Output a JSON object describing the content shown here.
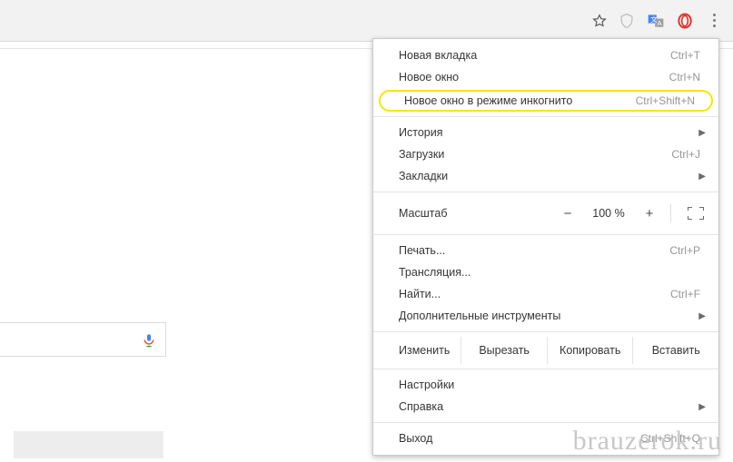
{
  "toolbar": {
    "star": "star-icon",
    "ext_shield": "shield-icon",
    "ext_translate": "translate-icon",
    "ext_opera": "opera-icon",
    "menu": "menu-icon"
  },
  "menu": {
    "new_tab": {
      "label": "Новая вкладка",
      "shortcut": "Ctrl+T"
    },
    "new_window": {
      "label": "Новое окно",
      "shortcut": "Ctrl+N"
    },
    "incognito": {
      "label": "Новое окно в режиме инкогнито",
      "shortcut": "Ctrl+Shift+N"
    },
    "history": {
      "label": "История"
    },
    "downloads": {
      "label": "Загрузки",
      "shortcut": "Ctrl+J"
    },
    "bookmarks": {
      "label": "Закладки"
    },
    "zoom": {
      "label": "Масштаб",
      "minus": "−",
      "value": "100 %",
      "plus": "+"
    },
    "print": {
      "label": "Печать...",
      "shortcut": "Ctrl+P"
    },
    "cast": {
      "label": "Трансляция..."
    },
    "find": {
      "label": "Найти...",
      "shortcut": "Ctrl+F"
    },
    "more_tools": {
      "label": "Дополнительные инструменты"
    },
    "edit": {
      "label": "Изменить",
      "cut": "Вырезать",
      "copy": "Копировать",
      "paste": "Вставить"
    },
    "settings": {
      "label": "Настройки"
    },
    "help": {
      "label": "Справка"
    },
    "exit": {
      "label": "Выход",
      "shortcut": "Ctrl+Shift+Q"
    }
  },
  "watermark": "brauzerok.ru"
}
